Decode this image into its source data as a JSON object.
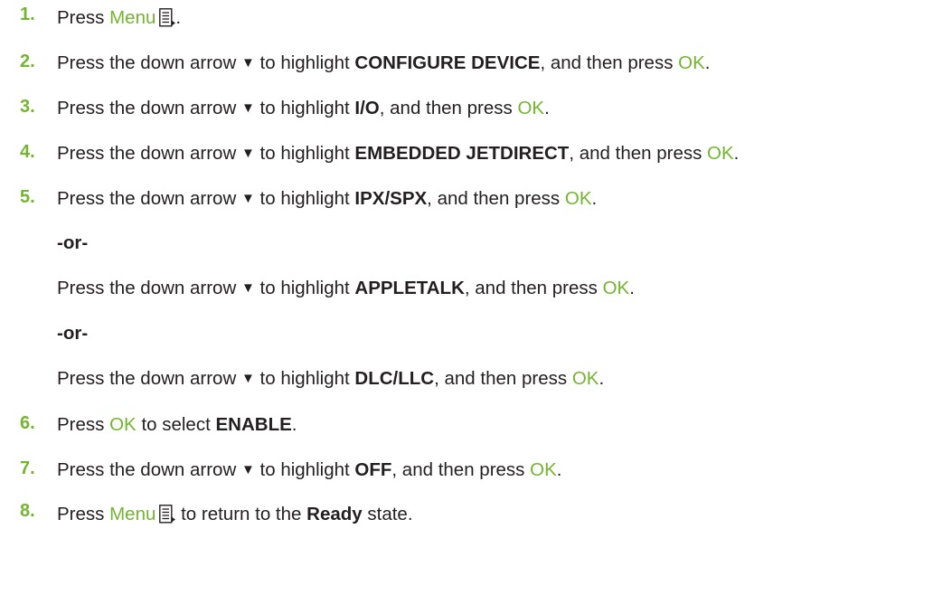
{
  "text": {
    "press": "Press",
    "press_the_down_arrow": "Press the down arrow",
    "to_highlight": "to highlight",
    "and_then_press": ", and then press",
    "menu": "Menu",
    "ok": "OK",
    "period": ".",
    "to_select": "to select",
    "to_return_to_the": "to return to the",
    "state": "state.",
    "or": "-or-",
    "down_arrow_glyph": "▼"
  },
  "steps": [
    {
      "number": "1."
    },
    {
      "number": "2.",
      "item": "CONFIGURE DEVICE"
    },
    {
      "number": "3.",
      "item": "I/O"
    },
    {
      "number": "4.",
      "item": "EMBEDDED JETDIRECT"
    },
    {
      "number": "5.",
      "item": "IPX/SPX",
      "alt1": "APPLETALK",
      "alt2": "DLC/LLC"
    },
    {
      "number": "6.",
      "item": "ENABLE"
    },
    {
      "number": "7.",
      "item": "OFF"
    },
    {
      "number": "8.",
      "item": "Ready"
    }
  ],
  "icons": {
    "menu_button": "menu-button-icon",
    "down_arrow": "down-arrow-icon"
  },
  "colors": {
    "accent_green": "#73b52f",
    "text": "#231f20"
  }
}
